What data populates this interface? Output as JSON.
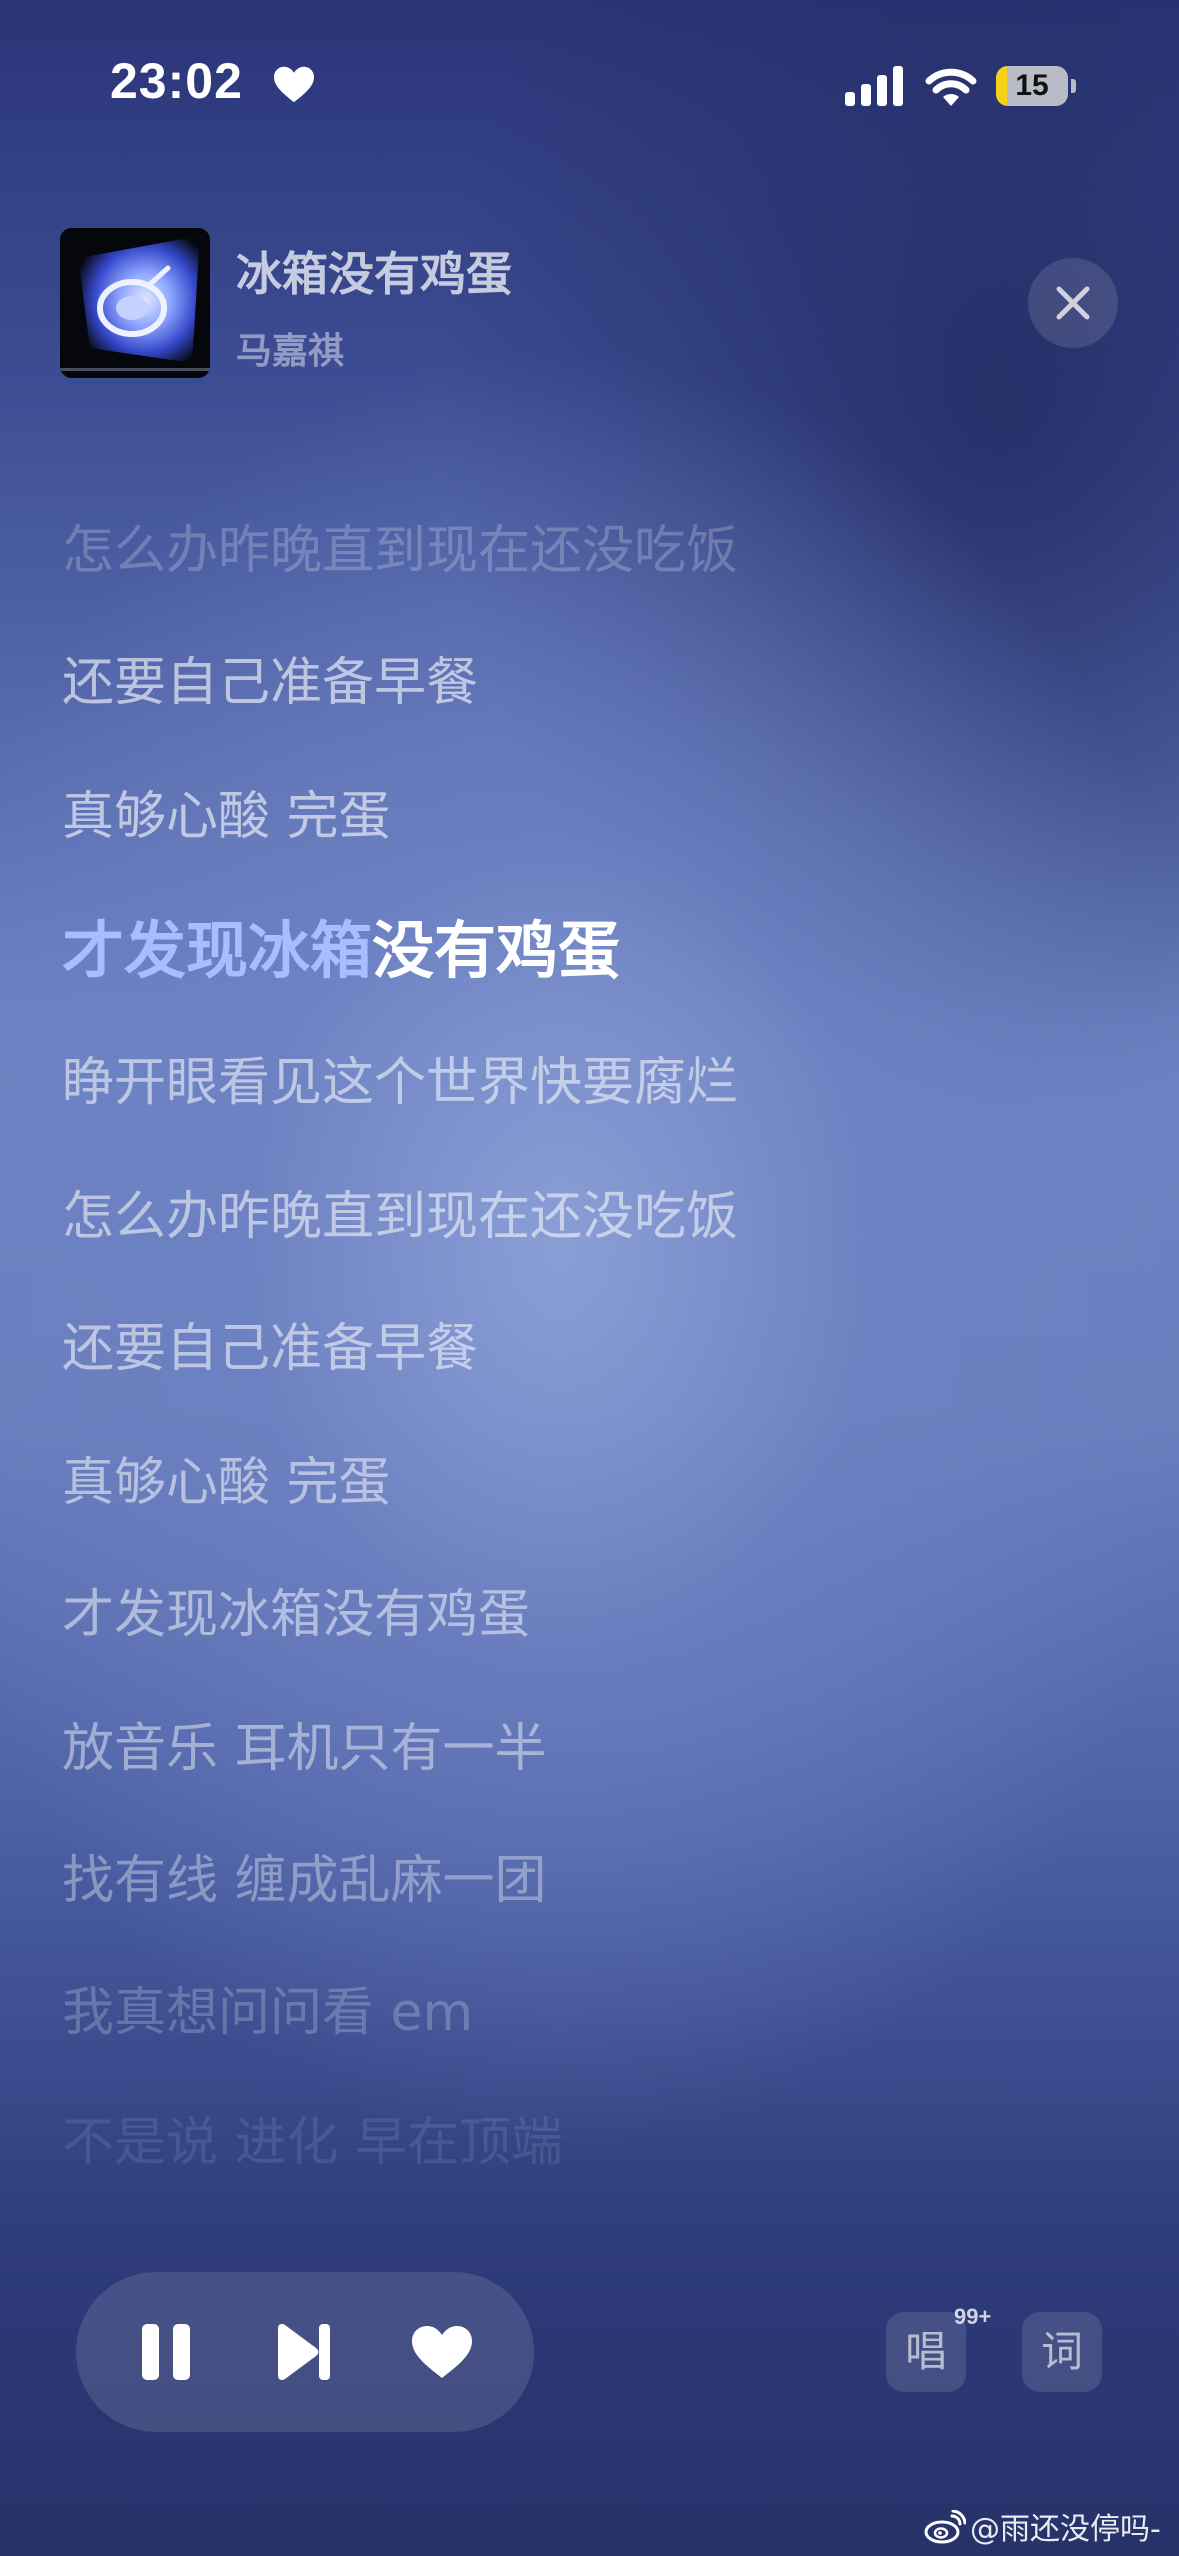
{
  "status_bar": {
    "time": "23:02",
    "battery_level": "15",
    "battery_fraction": 0.15,
    "icons": [
      "heart-icon",
      "signal-icon",
      "wifi-icon",
      "battery-icon"
    ]
  },
  "song": {
    "title": "冰箱没有鸡蛋",
    "artist": "马嘉祺"
  },
  "lyrics": {
    "current_sung": "才发现冰箱",
    "current_unsung": "没有鸡蛋",
    "lines": [
      "怎么办昨晚直到现在还没吃饭",
      "还要自己准备早餐",
      "真够心酸 完蛋",
      "才发现冰箱没有鸡蛋",
      "睁开眼看见这个世界快要腐烂",
      "怎么办昨晚直到现在还没吃饭",
      "还要自己准备早餐",
      "真够心酸 完蛋",
      "才发现冰箱没有鸡蛋",
      "放音乐 耳机只有一半",
      "找有线 缠成乱麻一团",
      "我真想问问看 em",
      "不是说 进化 早在顶端"
    ]
  },
  "controls": {
    "icons": [
      "pause-icon",
      "next-icon",
      "heart-icon"
    ],
    "sing_label": "唱",
    "sing_badge": "99+",
    "lyrics_label": "词"
  },
  "watermark": {
    "text": "@雨还没停吗-",
    "icon": "weibo-icon"
  },
  "colors": {
    "highlight_sung": "#a9bcff",
    "battery_fill": "#f5d21a"
  }
}
